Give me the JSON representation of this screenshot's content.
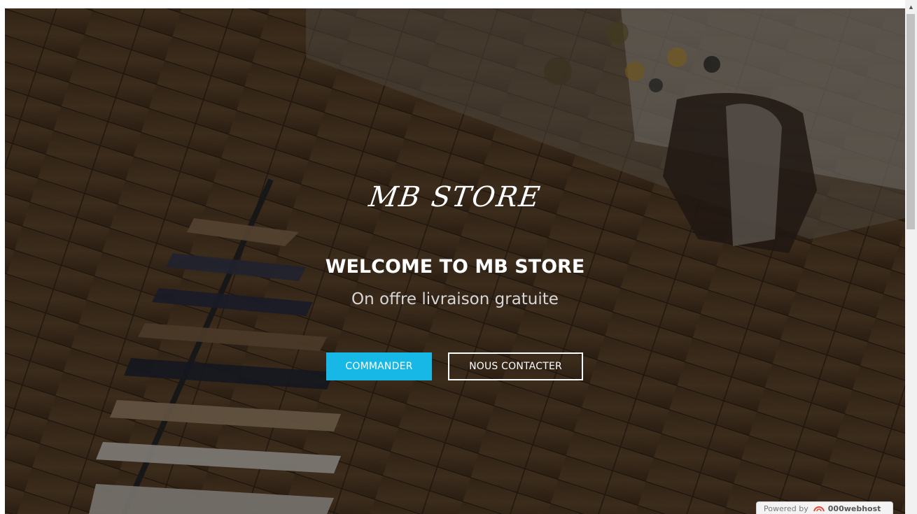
{
  "hero": {
    "logo_text": "MB STORE",
    "headline": "WELCOME TO MB STORE",
    "subline": "On offre livraison gratuite",
    "primary_button": "COMMANDER",
    "secondary_button": "NOUS CONTACTER",
    "background_icon": "clothing-store-floor-photo"
  },
  "badge": {
    "prefix": "Powered by",
    "host_name": "000webhost",
    "icon": "webhost-logo-icon"
  },
  "colors": {
    "accent": "#17b8e6",
    "text": "#ffffff"
  }
}
